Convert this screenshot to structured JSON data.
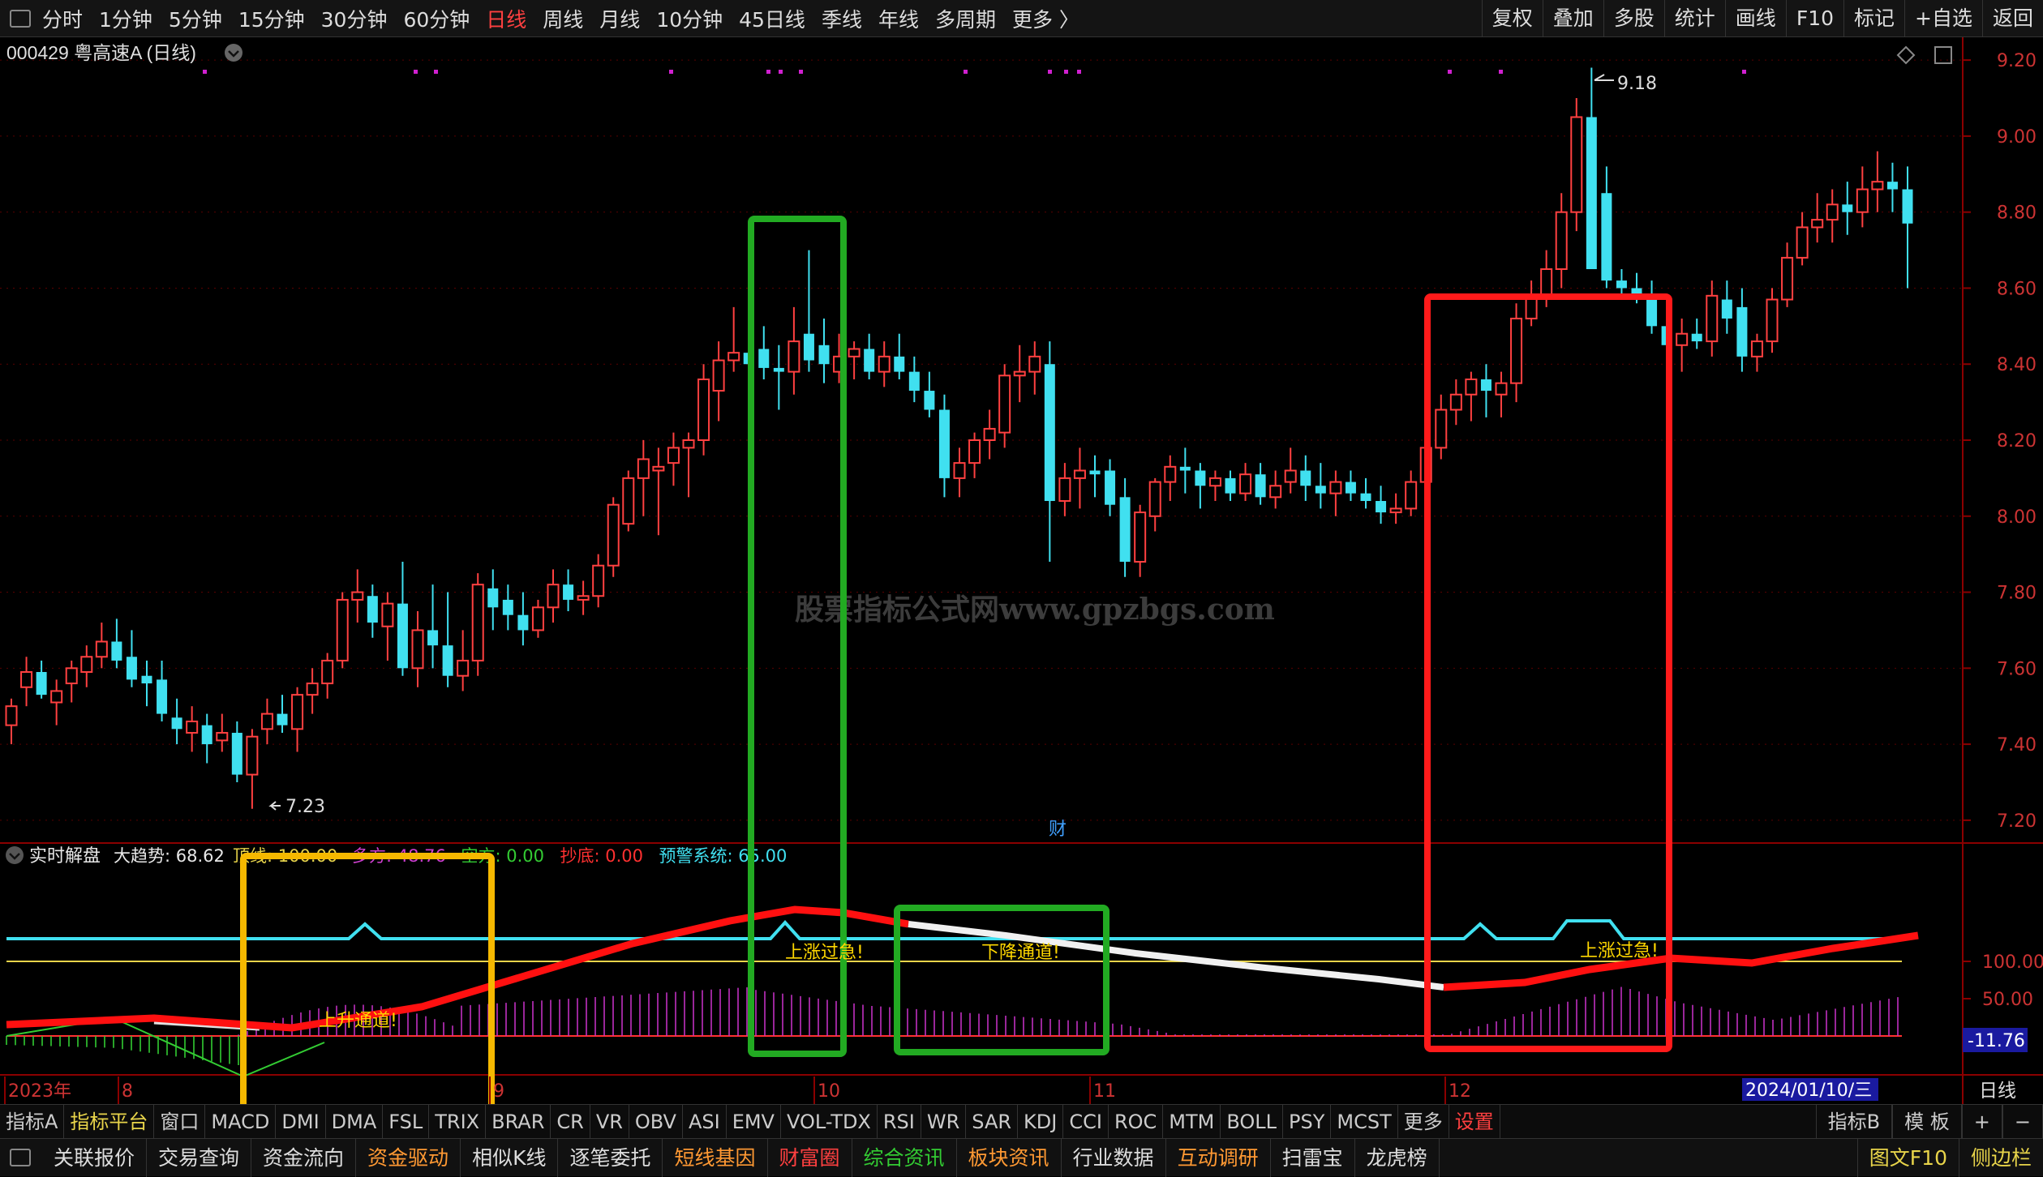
{
  "top_bar": {
    "periods": [
      "分时",
      "1分钟",
      "5分钟",
      "15分钟",
      "30分钟",
      "60分钟",
      "日线",
      "周线",
      "月线",
      "10分钟",
      "45日线",
      "季线",
      "年线",
      "多周期",
      "更多 〉"
    ],
    "active_period": "日线",
    "tools": [
      "复权",
      "叠加",
      "多股",
      "统计",
      "画线",
      "F10",
      "标记",
      "+自选",
      "返回"
    ]
  },
  "stock": {
    "title": "000429 粤高速A (日线)",
    "high_label": "9.18",
    "low_label": "7.23",
    "cai_marker": "财"
  },
  "price_axis": {
    "ticks": [
      "9.20",
      "9.00",
      "8.80",
      "8.60",
      "8.40",
      "8.20",
      "8.00",
      "7.80",
      "7.60",
      "7.40",
      "7.20"
    ]
  },
  "watermark": "股票指标公式网www.gpzbgs.com",
  "indicator": {
    "name": "实时解盘",
    "legend": [
      {
        "label": "大趋势: 68.62",
        "color": "#e8e8e8"
      },
      {
        "label": "顶线: 100.00",
        "color": "#e8d44a"
      },
      {
        "label": "多方: 48.76",
        "color": "#d040d0"
      },
      {
        "label": "空方: 0.00",
        "color": "#33cc33"
      },
      {
        "label": "抄底: 0.00",
        "color": "#ff3030"
      },
      {
        "label": "预警系统: 65.00",
        "color": "#40e0f0"
      }
    ],
    "ticks": [
      "100.00",
      "50.00"
    ],
    "current_value": "-11.76",
    "annotations": [
      "上升通道!",
      "上涨过急!",
      "下降通道!",
      "上涨过急!"
    ]
  },
  "time_axis": {
    "labels": [
      "2023年",
      "8",
      "9",
      "10",
      "11",
      "12"
    ],
    "cursor_date": "2024/01/10/三",
    "period_label": "日线"
  },
  "indicator_tabs": {
    "left": [
      "指标A",
      "指标平台",
      "窗口",
      "MACD",
      "DMI",
      "DMA",
      "FSL",
      "TRIX",
      "BRAR",
      "CR",
      "VR",
      "OBV",
      "ASI",
      "EMV",
      "VOL-TDX",
      "RSI",
      "WR",
      "SAR",
      "KDJ",
      "CCI",
      "ROC",
      "MTM",
      "BOLL",
      "PSY",
      "MCST",
      "更多",
      "设置"
    ],
    "right": [
      "指标B",
      "模 板",
      "+",
      "−"
    ]
  },
  "link_bar": {
    "items": [
      "关联报价",
      "交易查询",
      "资金流向",
      "资金驱动",
      "相似K线",
      "逐笔委托",
      "短线基因",
      "财富圈",
      "综合资讯",
      "板块资讯",
      "行业数据",
      "互动调研",
      "扫雷宝",
      "龙虎榜"
    ],
    "right": [
      "图文F10",
      "侧边栏"
    ]
  },
  "colors": {
    "up": "#ff4040",
    "down": "#40e0f0",
    "grid": "#5a0000",
    "axis_text": "#cc3333"
  },
  "chart_data": {
    "type": "candlestick",
    "ylim": [
      7.14,
      9.26
    ],
    "candles": [
      [
        7.45,
        7.52,
        7.4,
        7.5
      ],
      [
        7.55,
        7.63,
        7.5,
        7.59
      ],
      [
        7.59,
        7.62,
        7.52,
        7.53
      ],
      [
        7.51,
        7.57,
        7.45,
        7.54
      ],
      [
        7.56,
        7.62,
        7.51,
        7.6
      ],
      [
        7.59,
        7.66,
        7.55,
        7.63
      ],
      [
        7.63,
        7.72,
        7.6,
        7.67
      ],
      [
        7.67,
        7.73,
        7.6,
        7.62
      ],
      [
        7.63,
        7.7,
        7.55,
        7.57
      ],
      [
        7.58,
        7.62,
        7.5,
        7.56
      ],
      [
        7.57,
        7.62,
        7.46,
        7.48
      ],
      [
        7.47,
        7.52,
        7.4,
        7.44
      ],
      [
        7.43,
        7.5,
        7.38,
        7.46
      ],
      [
        7.45,
        7.48,
        7.35,
        7.4
      ],
      [
        7.41,
        7.48,
        7.38,
        7.43
      ],
      [
        7.43,
        7.46,
        7.3,
        7.32
      ],
      [
        7.32,
        7.44,
        7.23,
        7.42
      ],
      [
        7.44,
        7.52,
        7.4,
        7.48
      ],
      [
        7.48,
        7.53,
        7.43,
        7.45
      ],
      [
        7.44,
        7.55,
        7.38,
        7.53
      ],
      [
        7.53,
        7.6,
        7.48,
        7.56
      ],
      [
        7.56,
        7.64,
        7.52,
        7.62
      ],
      [
        7.62,
        7.8,
        7.6,
        7.78
      ],
      [
        7.78,
        7.86,
        7.72,
        7.8
      ],
      [
        7.79,
        7.82,
        7.68,
        7.72
      ],
      [
        7.71,
        7.8,
        7.62,
        7.77
      ],
      [
        7.77,
        7.88,
        7.58,
        7.6
      ],
      [
        7.6,
        7.75,
        7.55,
        7.7
      ],
      [
        7.7,
        7.82,
        7.6,
        7.66
      ],
      [
        7.66,
        7.8,
        7.55,
        7.58
      ],
      [
        7.58,
        7.7,
        7.54,
        7.62
      ],
      [
        7.62,
        7.85,
        7.58,
        7.82
      ],
      [
        7.81,
        7.86,
        7.7,
        7.76
      ],
      [
        7.78,
        7.82,
        7.7,
        7.74
      ],
      [
        7.74,
        7.8,
        7.66,
        7.7
      ],
      [
        7.7,
        7.78,
        7.68,
        7.76
      ],
      [
        7.76,
        7.86,
        7.72,
        7.82
      ],
      [
        7.82,
        7.86,
        7.75,
        7.78
      ],
      [
        7.78,
        7.83,
        7.74,
        7.79
      ],
      [
        7.79,
        7.9,
        7.76,
        7.87
      ],
      [
        7.87,
        8.05,
        7.84,
        8.03
      ],
      [
        7.98,
        8.12,
        7.96,
        8.1
      ],
      [
        8.1,
        8.2,
        8.0,
        8.15
      ],
      [
        8.12,
        8.18,
        7.95,
        8.13
      ],
      [
        8.14,
        8.22,
        8.08,
        8.18
      ],
      [
        8.18,
        8.22,
        8.05,
        8.2
      ],
      [
        8.2,
        8.4,
        8.16,
        8.36
      ],
      [
        8.33,
        8.46,
        8.25,
        8.41
      ],
      [
        8.41,
        8.55,
        8.38,
        8.43
      ],
      [
        8.43,
        8.5,
        8.35,
        8.4
      ],
      [
        8.44,
        8.5,
        8.36,
        8.39
      ],
      [
        8.39,
        8.45,
        8.28,
        8.38
      ],
      [
        8.38,
        8.55,
        8.32,
        8.46
      ],
      [
        8.48,
        8.7,
        8.38,
        8.41
      ],
      [
        8.45,
        8.52,
        8.35,
        8.4
      ],
      [
        8.38,
        8.48,
        8.35,
        8.42
      ],
      [
        8.42,
        8.46,
        8.36,
        8.44
      ],
      [
        8.44,
        8.48,
        8.36,
        8.38
      ],
      [
        8.38,
        8.46,
        8.34,
        8.42
      ],
      [
        8.42,
        8.48,
        8.36,
        8.38
      ],
      [
        8.38,
        8.42,
        8.3,
        8.33
      ],
      [
        8.33,
        8.38,
        8.26,
        8.28
      ],
      [
        8.28,
        8.32,
        8.05,
        8.1
      ],
      [
        8.1,
        8.18,
        8.05,
        8.14
      ],
      [
        8.14,
        8.22,
        8.1,
        8.2
      ],
      [
        8.2,
        8.28,
        8.15,
        8.23
      ],
      [
        8.22,
        8.4,
        8.18,
        8.37
      ],
      [
        8.37,
        8.45,
        8.3,
        8.38
      ],
      [
        8.38,
        8.46,
        8.32,
        8.42
      ],
      [
        8.4,
        8.46,
        7.88,
        8.04
      ],
      [
        8.04,
        8.14,
        8.0,
        8.1
      ],
      [
        8.1,
        8.18,
        8.02,
        8.12
      ],
      [
        8.12,
        8.16,
        8.05,
        8.11
      ],
      [
        8.12,
        8.15,
        8.0,
        8.03
      ],
      [
        8.05,
        8.1,
        7.84,
        7.88
      ],
      [
        7.88,
        8.03,
        7.84,
        8.01
      ],
      [
        8.0,
        8.1,
        7.96,
        8.09
      ],
      [
        8.09,
        8.16,
        8.04,
        8.13
      ],
      [
        8.13,
        8.18,
        8.06,
        8.12
      ],
      [
        8.12,
        8.14,
        8.02,
        8.08
      ],
      [
        8.08,
        8.12,
        8.04,
        8.1
      ],
      [
        8.1,
        8.12,
        8.04,
        8.06
      ],
      [
        8.06,
        8.14,
        8.04,
        8.11
      ],
      [
        8.11,
        8.14,
        8.03,
        8.05
      ],
      [
        8.05,
        8.12,
        8.02,
        8.08
      ],
      [
        8.09,
        8.18,
        8.06,
        8.12
      ],
      [
        8.12,
        8.16,
        8.04,
        8.08
      ],
      [
        8.08,
        8.14,
        8.02,
        8.06
      ],
      [
        8.06,
        8.12,
        8.0,
        8.09
      ],
      [
        8.09,
        8.12,
        8.04,
        8.06
      ],
      [
        8.06,
        8.1,
        8.02,
        8.04
      ],
      [
        8.04,
        8.08,
        7.98,
        8.01
      ],
      [
        8.01,
        8.06,
        7.98,
        8.02
      ],
      [
        8.02,
        8.12,
        8.0,
        8.09
      ],
      [
        8.09,
        8.2,
        8.05,
        8.18
      ],
      [
        8.18,
        8.32,
        8.15,
        8.28
      ],
      [
        8.28,
        8.36,
        8.24,
        8.32
      ],
      [
        8.32,
        8.38,
        8.25,
        8.36
      ],
      [
        8.36,
        8.4,
        8.26,
        8.33
      ],
      [
        8.32,
        8.38,
        8.26,
        8.35
      ],
      [
        8.35,
        8.56,
        8.3,
        8.52
      ],
      [
        8.52,
        8.62,
        8.5,
        8.58
      ],
      [
        8.58,
        8.7,
        8.55,
        8.65
      ],
      [
        8.65,
        8.85,
        8.6,
        8.8
      ],
      [
        8.8,
        9.1,
        8.75,
        9.05
      ],
      [
        9.05,
        9.18,
        8.7,
        8.65
      ],
      [
        8.85,
        8.92,
        8.6,
        8.62
      ],
      [
        8.62,
        8.65,
        8.58,
        8.6
      ],
      [
        8.6,
        8.64,
        8.56,
        8.58
      ],
      [
        8.58,
        8.62,
        8.48,
        8.5
      ],
      [
        8.5,
        8.54,
        8.38,
        8.45
      ],
      [
        8.45,
        8.52,
        8.38,
        8.48
      ],
      [
        8.48,
        8.52,
        8.44,
        8.46
      ],
      [
        8.46,
        8.62,
        8.42,
        8.58
      ],
      [
        8.57,
        8.62,
        8.48,
        8.52
      ],
      [
        8.55,
        8.6,
        8.38,
        8.42
      ],
      [
        8.42,
        8.48,
        8.38,
        8.46
      ],
      [
        8.46,
        8.6,
        8.43,
        8.57
      ],
      [
        8.57,
        8.72,
        8.55,
        8.68
      ],
      [
        8.68,
        8.8,
        8.66,
        8.76
      ],
      [
        8.76,
        8.85,
        8.72,
        8.78
      ],
      [
        8.78,
        8.86,
        8.72,
        8.82
      ],
      [
        8.82,
        8.88,
        8.74,
        8.8
      ],
      [
        8.8,
        8.92,
        8.76,
        8.86
      ],
      [
        8.86,
        8.96,
        8.8,
        8.88
      ],
      [
        8.88,
        8.93,
        8.8,
        8.86
      ],
      [
        8.86,
        8.92,
        8.6,
        8.77
      ]
    ]
  }
}
